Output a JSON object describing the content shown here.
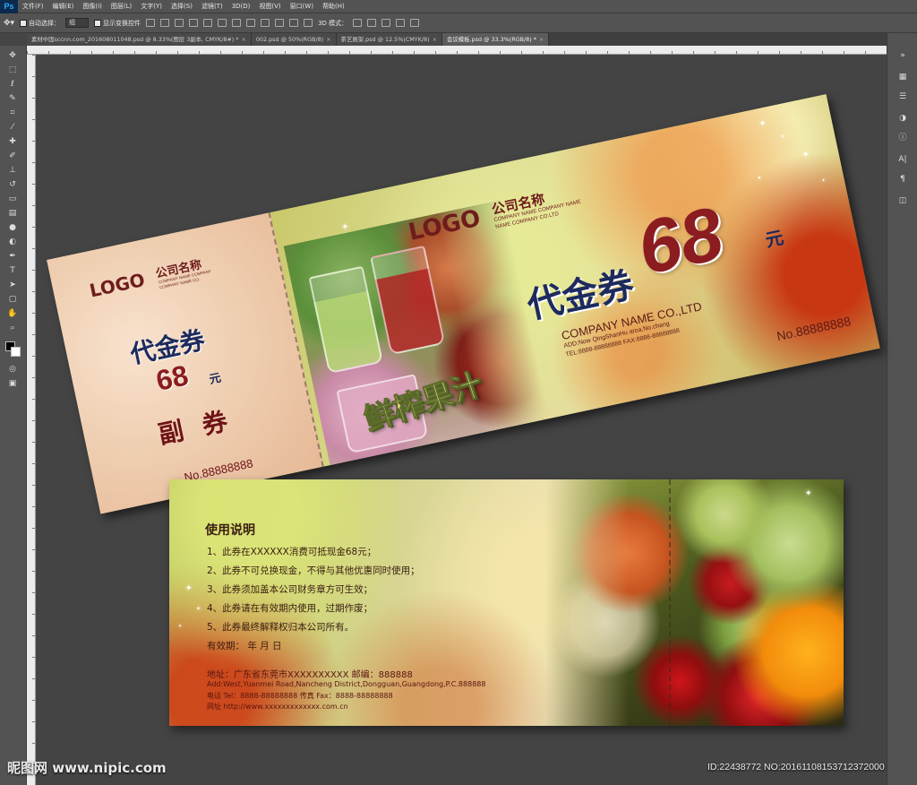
{
  "app": {
    "logo": "Ps"
  },
  "menu": [
    "文件(F)",
    "编辑(E)",
    "图像(I)",
    "图层(L)",
    "文字(Y)",
    "选择(S)",
    "滤镜(T)",
    "3D(D)",
    "视图(V)",
    "窗口(W)",
    "帮助(H)"
  ],
  "options": {
    "auto_select_label": "自动选择：",
    "auto_select_value": "组",
    "transform_label": "显示变换控件",
    "mode_3d_label": "3D 模式："
  },
  "tabs": [
    {
      "label": "素材中国sccnn.com_201608011048.psd @ 8.33%(图层 3副本, CMYK/8#) *",
      "active": false
    },
    {
      "label": "002.psd @ 50%(RGB/8)",
      "active": false
    },
    {
      "label": "茶艺展架.psd @ 12.5%(CMYK/8)",
      "active": false
    },
    {
      "label": "会议模板.psd @ 33.3%(RGB/8) *",
      "active": true
    }
  ],
  "tab_close": "×",
  "voucher_top": {
    "stub": {
      "logo": "LOGO",
      "company_cn": "公司名称",
      "company_en_1": "COMPANY NAME COMPANY",
      "company_en_2": "COMPANY NAME CO.",
      "title": "代金券",
      "amount": "68",
      "unit": "元",
      "sub": "副 券",
      "number": "No.88888888"
    },
    "main": {
      "logo": "LOGO",
      "company_cn": "公司名称",
      "company_en_1": "COMPANY NAME COMPANY NAME",
      "company_en_2": "NAME COMPANY CO.LTD",
      "title": "代金券",
      "amount": "68",
      "unit": "元",
      "product": "鲜榨果汁",
      "company_ltd": "COMPANY NAME CO.,LTD",
      "address": "ADD:Now QingShanHu aroa.No.chang",
      "tel": "TEL:8888-88888888  FAX:8888-88888888",
      "number": "No.88888888"
    }
  },
  "voucher_bottom": {
    "heading": "使用说明",
    "rules": [
      "1、此券在XXXXXX消费可抵现金68元；",
      "2、此券不可兑换现金，不得与其他优惠同时使用；",
      "3、此券须加盖本公司财务章方可生效；",
      "4、此券请在有效期内使用，过期作废；",
      "5、此券最终解释权归本公司所有。"
    ],
    "validity": "有效期：       年    月    日",
    "address_cn": "地址：广东省东莞市XXXXXXXXXX    邮编：888888",
    "address_en": "Add:West,Yuanmei Road,Nancheng District,Dongguan,Guangdong,P.C.888888",
    "phone": "电话 Tel：8888-88888888         传真 Fax：8888-88888888",
    "web": "网址 http://www.xxxxxxxxxxxxx.com.cn"
  },
  "watermark": {
    "left": "昵图网 www.nipic.com",
    "right": "ID:22438772 NO:20161108153712372000"
  }
}
